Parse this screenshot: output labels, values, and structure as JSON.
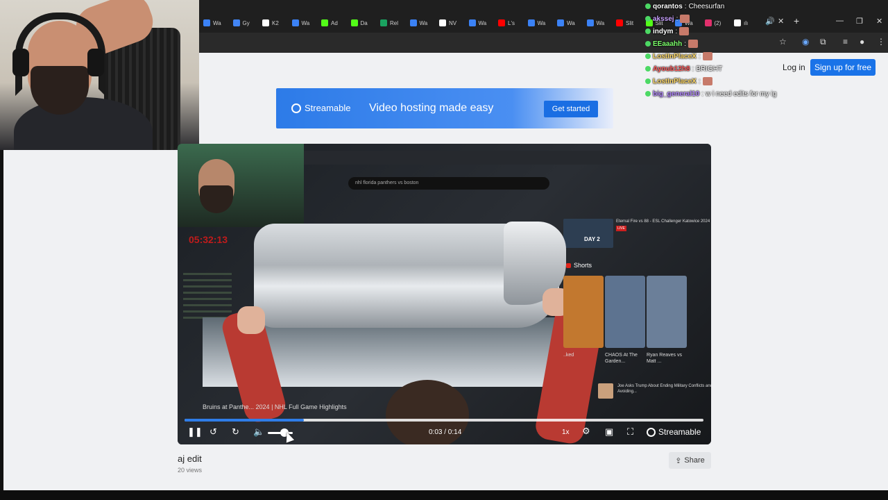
{
  "browser": {
    "tabs": [
      {
        "label": "Wa",
        "icon": "globe-icon",
        "color": "#3b82f6"
      },
      {
        "label": "Gy",
        "icon": "google-icon",
        "color": "#4285f4"
      },
      {
        "label": "K2",
        "icon": "x-icon",
        "color": "#ffffff"
      },
      {
        "label": "Wa",
        "icon": "globe-icon",
        "color": "#3b82f6"
      },
      {
        "label": "Ad",
        "icon": "kick-icon",
        "color": "#53fc18"
      },
      {
        "label": "Da",
        "icon": "kick-icon",
        "color": "#53fc18"
      },
      {
        "label": "Rel",
        "icon": "sheet-icon",
        "color": "#1aa260"
      },
      {
        "label": "Wa",
        "icon": "globe-icon",
        "color": "#3b82f6"
      },
      {
        "label": "NV",
        "icon": "x-icon",
        "color": "#ffffff"
      },
      {
        "label": "Wa",
        "icon": "globe-icon",
        "color": "#3b82f6"
      },
      {
        "label": "L's",
        "icon": "youtube-icon",
        "color": "#ff0000"
      },
      {
        "label": "Wa",
        "icon": "globe-icon",
        "color": "#3b82f6"
      },
      {
        "label": "Wa",
        "icon": "globe-icon",
        "color": "#3b82f6"
      },
      {
        "label": "Wa",
        "icon": "globe-icon",
        "color": "#3b82f6"
      },
      {
        "label": "Slit",
        "icon": "youtube-icon",
        "color": "#ff0000"
      },
      {
        "label": "Slit",
        "icon": "kick-icon",
        "color": "#53fc18"
      },
      {
        "label": "Wa",
        "icon": "globe-icon",
        "color": "#3b82f6"
      },
      {
        "label": "(2)",
        "icon": "instagram-icon",
        "color": "#e1306c"
      },
      {
        "label": "ılı",
        "icon": "tiktok-icon",
        "color": "#ffffff"
      }
    ]
  },
  "chat": {
    "lines": [
      {
        "user": "qorantos",
        "text": "Cheesurfan",
        "color": "#ffffff"
      },
      {
        "user": "akssej",
        "text": "",
        "color": "#c9a2ff"
      },
      {
        "user": "indym",
        "text": "",
        "color": "#ffffff"
      },
      {
        "user": "EEaaahh",
        "text": "",
        "color": "#7cff6b"
      },
      {
        "user": "LostInPlaceX",
        "text": "",
        "color": "#ffd966"
      },
      {
        "user": "Ayoub12h8",
        "text": "BRIGHT",
        "color": "#ff5a5a"
      },
      {
        "user": "LostInPlaceX",
        "text": "",
        "color": "#ffd966"
      },
      {
        "user": "big_general10",
        "text": "w i need edits for my ig",
        "color": "#b388ff"
      }
    ]
  },
  "header": {
    "login_label": "Log in",
    "signup_label": "Sign up for free"
  },
  "banner": {
    "brand": "Streamable",
    "tagline": "Video hosting made easy",
    "cta": "Get started"
  },
  "frame": {
    "search_text": "nhl florida panthers vs boston",
    "timer": "05:32:13",
    "shorts_label": "Shorts",
    "day_label": "DAY 2",
    "rec_title": "Eternal Fire vs 88 - ESL Challenger Katowice 2024 -",
    "live_label": "LIVE",
    "shorts": [
      {
        "caption": "..ked"
      },
      {
        "caption": "CHAOS At The Garden..."
      },
      {
        "caption": "Ryan Reaves vs Matt ..."
      }
    ],
    "video_title": "Bruins at Panthe... 2024 | NHL Full Game Highlights",
    "news": "Joe Asks Trump About Ending Military Conflicts and Avoiding..."
  },
  "player": {
    "time": "0:03 / 0:14",
    "progress": 0.23,
    "volume": 0.5,
    "speed": "1x",
    "brand": "Streamable"
  },
  "video": {
    "title": "aj edit",
    "views": "20 views",
    "share_label": "Share"
  }
}
